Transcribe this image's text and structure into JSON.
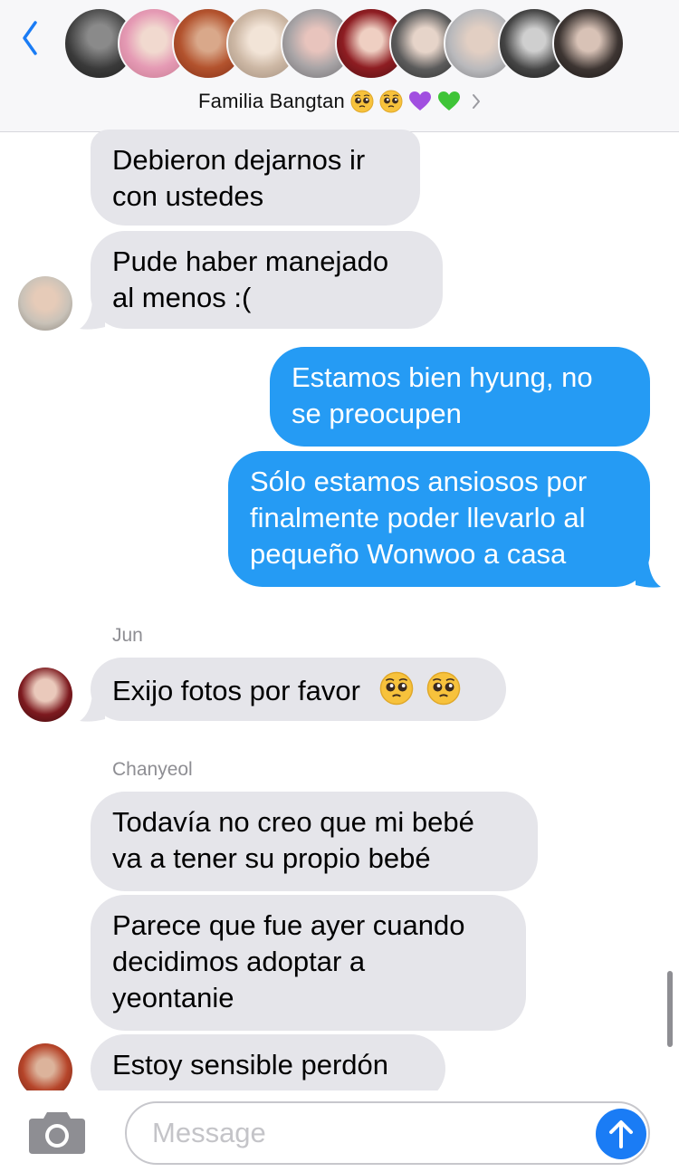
{
  "header": {
    "group_name": "Familia Bangtan",
    "title_emojis": [
      "pleading-face",
      "pleading-face",
      "purple-heart",
      "green-heart"
    ],
    "participant_count_shown": 10
  },
  "messages": [
    {
      "dir": "in",
      "lines": [
        "Debieron dejarnos ir",
        "con ustedes"
      ]
    },
    {
      "dir": "in",
      "lines": [
        "Pude haber manejado",
        "al menos :("
      ]
    },
    {
      "dir": "out",
      "lines": [
        "Estamos bien hyung, no",
        "se preocupen"
      ]
    },
    {
      "dir": "out",
      "lines": [
        "Sólo estamos ansiosos por",
        "finalmente poder llevarlo al",
        "pequeño Wonwoo a casa"
      ]
    },
    {
      "sender": "Jun",
      "dir": "in",
      "lines": [
        "Exijo fotos por favor"
      ],
      "emojis": [
        "pleading-face",
        "pleading-face"
      ]
    },
    {
      "sender": "Chanyeol",
      "dir": "in",
      "lines": [
        "Todavía no creo que mi bebé",
        "va a tener su propio bebé"
      ]
    },
    {
      "dir": "in",
      "lines": [
        "Parece que fue ayer cuando",
        "decidimos adoptar a",
        "yeontanie"
      ]
    },
    {
      "dir": "in",
      "lines": [
        "Estoy sensible perdón"
      ]
    }
  ],
  "composer": {
    "placeholder": "Message"
  },
  "colors": {
    "incoming_bubble": "#e5e5ea",
    "outgoing_bubble": "#259bf4",
    "accent": "#1a7cf5",
    "header_bg": "#f7f7f9"
  }
}
